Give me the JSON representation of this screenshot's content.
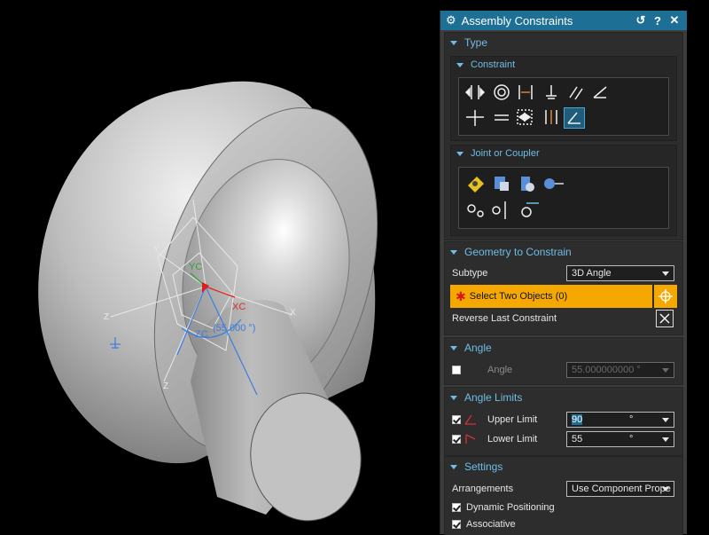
{
  "viewport": {
    "labels": {
      "yc": "YC",
      "xc": "XC",
      "zc": "ZC",
      "y_top": "Y",
      "y_left": "Y",
      "z_left": "Z",
      "z_bottom": "Z",
      "x_right": "X",
      "angle": "(55.000 °)"
    }
  },
  "dialog": {
    "title": "Assembly Constraints",
    "type_section": {
      "label": "Type",
      "constraint_label": "Constraint",
      "joint_label": "Joint or Coupler"
    },
    "geometry": {
      "label": "Geometry to Constrain",
      "subtype_label": "Subtype",
      "subtype_value": "3D Angle",
      "select_label": "Select Two Objects (0)",
      "reverse_label": "Reverse Last Constraint"
    },
    "angle": {
      "label": "Angle",
      "field_label": "Angle",
      "value": "55.000000000 °",
      "checked": false
    },
    "angle_limits": {
      "label": "Angle Limits",
      "upper_label": "Upper Limit",
      "upper_value": "90",
      "upper_unit": "°",
      "lower_label": "Lower Limit",
      "lower_value": "55",
      "lower_unit": "°"
    },
    "settings": {
      "label": "Settings",
      "arrangements_label": "Arrangements",
      "arrangements_value": "Use Component Prope",
      "dynamic_label": "Dynamic Positioning",
      "associative_label": "Associative"
    }
  },
  "colors": {
    "title_bar": "#1d6f95",
    "section_header": "#6fbde6",
    "select_highlight": "#f5a800"
  }
}
